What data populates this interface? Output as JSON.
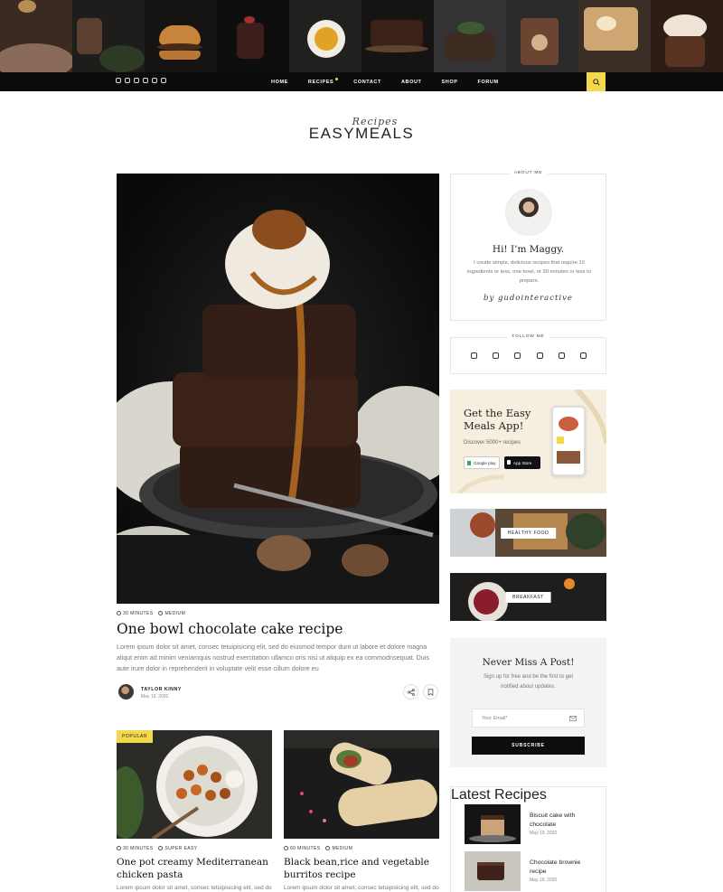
{
  "nav": {
    "menu": [
      {
        "label": "Home"
      },
      {
        "label": "Recipes"
      },
      {
        "label": "Contact"
      },
      {
        "label": "About"
      },
      {
        "label": "Shop"
      },
      {
        "label": "Forum"
      }
    ],
    "social_icons": [
      "instagram-icon",
      "twitter-icon",
      "facebook-icon",
      "pinterest-icon",
      "rss-icon",
      "youtube-icon"
    ],
    "search_icon": "search-icon"
  },
  "logo": {
    "script": "Recipes",
    "main": "EASYMEALS"
  },
  "hero": {
    "time": "30 Minutes",
    "difficulty": "Medium",
    "title": "One bowl chocolate cake recipe",
    "excerpt": "Lorem ipsum dolor sit amet, consec tetuipisicing elit, sed do eiusmod tempor dunt ut labore et dolore magna aliqut enim ad minim veniamquis nostrud exercitation ullamco oris nisi ut aliquip ex ea commodnsequat. Duis aute irure dolor in reprehenderit in voluptate velit esse cillum dolore eu",
    "author": "Taylor Kinny",
    "date": "May 19, 2020"
  },
  "cards": [
    {
      "badge": "Popular",
      "time": "30 Minutes",
      "difficulty": "Super Easy",
      "title": "One pot creamy Mediterranean chicken pasta",
      "excerpt": "Lorem ipsum dolor sit amet, consec tetuipisicing elit, sed do"
    },
    {
      "time": "60 Minutes",
      "difficulty": "Medium",
      "title": "Black bean,rice and vegetable burritos recipe",
      "excerpt": "Lorem ipsum dolor sit amet, consec tetuipisicing elit, sed do"
    }
  ],
  "sidebar": {
    "about": {
      "title": "About Me",
      "greeting": "Hi! I’m Maggy.",
      "text": "I create simple, delicious recipes that require 10 ingredients or less, one bowl, or 30 minutes or less to prepare.",
      "signature": "by gudointeractive"
    },
    "follow": {
      "title": "Follow Me",
      "icons": [
        "instagram-icon",
        "twitter-icon",
        "facebook-icon",
        "pinterest-icon",
        "rss-icon",
        "youtube-icon"
      ]
    },
    "app": {
      "title": "Get the Easy Meals App!",
      "subtitle": "Discover 5000+ recipes",
      "google_play": "Google play",
      "app_store": "App Store"
    },
    "categories": [
      {
        "label": "Healthy Food"
      },
      {
        "label": "Breakfast"
      }
    ],
    "newsletter": {
      "title": "Never Miss A Post!",
      "text": "Sign up for free and be the first to get notified about updates.",
      "placeholder": "Your Email*",
      "button": "Subscribe"
    },
    "latest": {
      "title": "Latest Recipes",
      "items": [
        {
          "title": "Biscuit cake with chocolate",
          "date": "May 19, 2020"
        },
        {
          "title": "Chocolate brownie recipe",
          "date": "May 19, 2020"
        }
      ]
    }
  },
  "colors": {
    "accent": "#f4d84b",
    "dark": "#0c0c0c"
  }
}
